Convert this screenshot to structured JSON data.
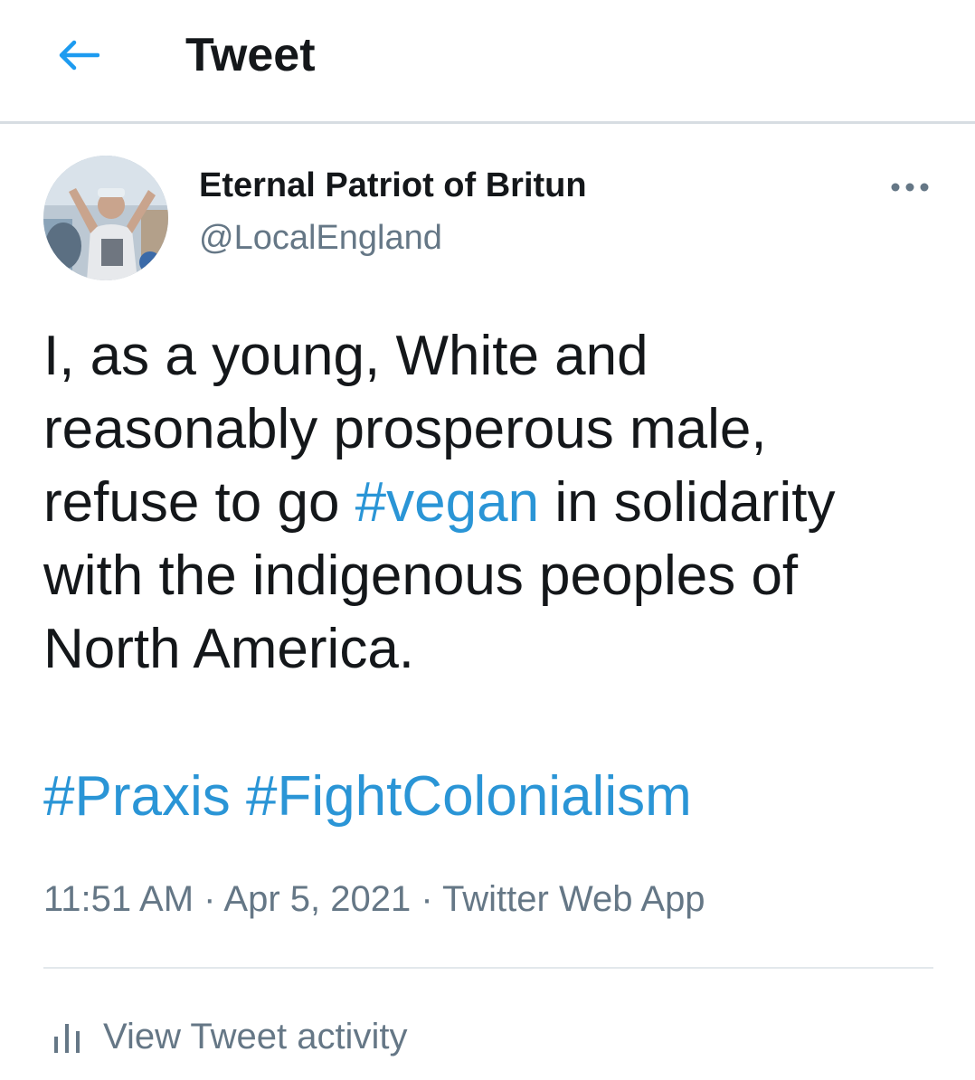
{
  "header": {
    "title": "Tweet",
    "back_icon": "arrow-left-icon"
  },
  "tweet": {
    "author": {
      "display_name": "Eternal Patriot of Britun",
      "handle": "@LocalEngland"
    },
    "more_icon": "more-horizontal-icon",
    "text_lines": [
      "I, as a young, White and",
      "reasonably prosperous male,",
      [
        "refuse to go ",
        "#vegan",
        " in solidarity"
      ],
      "with the indigenous peoples of",
      "North America."
    ],
    "line1": "I, as a young, White and",
    "line2": "reasonably prosperous male,",
    "line3_pre": "refuse to go ",
    "line3_tag": "#vegan",
    "line3_post": " in solidarity",
    "line4": "with the indigenous peoples of",
    "line5": "North America.",
    "hashtags": [
      "#Praxis",
      "#FightColonialism"
    ],
    "time": "11:51 AM",
    "separator": " · ",
    "date": "Apr 5, 2021",
    "source": "Twitter Web App"
  },
  "activity": {
    "label": "View Tweet activity",
    "icon": "analytics-icon"
  },
  "colors": {
    "accent": "#1d9bf0",
    "text": "#14171a",
    "secondary": "#657786",
    "divider": "#e3e8ec"
  }
}
